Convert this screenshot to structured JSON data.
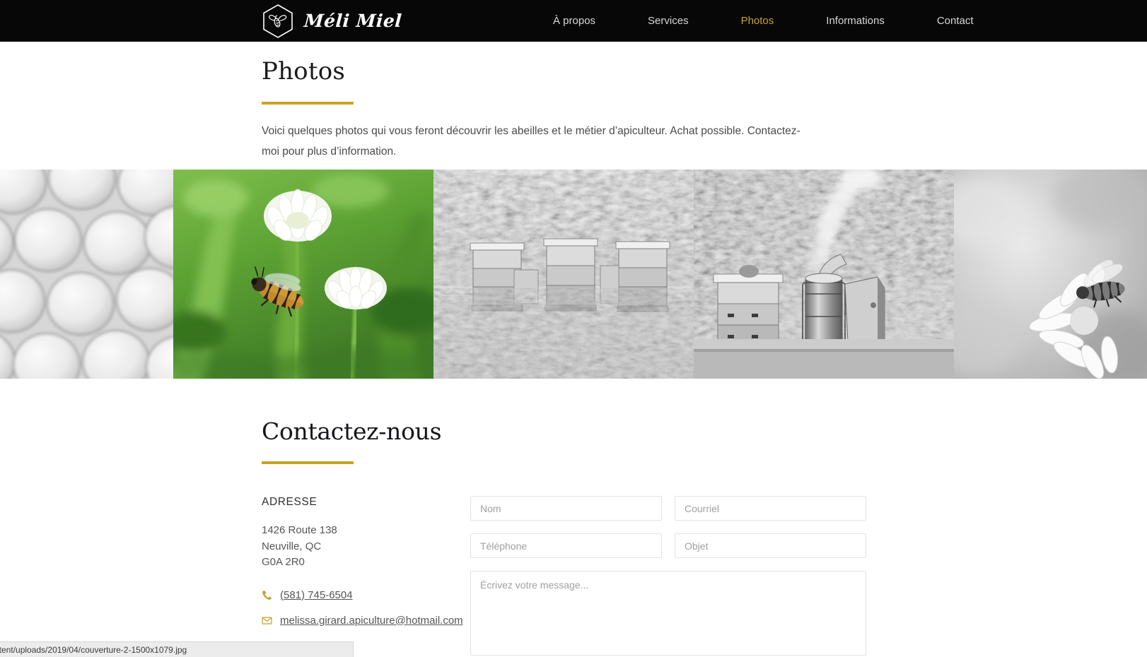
{
  "header": {
    "brand_name": "Méli Miel",
    "logo_icon": "hexagon-bee-icon",
    "nav": [
      {
        "label": "À propos",
        "active": false
      },
      {
        "label": "Services",
        "active": false
      },
      {
        "label": "Photos",
        "active": true
      },
      {
        "label": "Informations",
        "active": false
      },
      {
        "label": "Contact",
        "active": false
      }
    ]
  },
  "intro": {
    "title": "Photos",
    "text": "Voici quelques photos qui vous feront découvrir les abeilles et le métier d’apiculteur. Achat possible. Contactez-moi pour plus d’information."
  },
  "gallery": {
    "tiles": [
      {
        "name": "honeycomb-photo",
        "alt": "Gros plan de rayon de miel",
        "color": false
      },
      {
        "name": "bee-on-clover-photo",
        "alt": "Abeille sur une fleur de trèfle blanc",
        "color": true
      },
      {
        "name": "apiary-hives-photo",
        "alt": "Ruches dans un champ",
        "color": false
      },
      {
        "name": "smoker-hive-photo",
        "alt": "Enfumoir et ruche",
        "color": false
      },
      {
        "name": "bee-on-flower-photo",
        "alt": "Abeille sur une fleur blanche",
        "color": false
      }
    ]
  },
  "contact": {
    "title": "Contactez-nous",
    "address_label": "ADRESSE",
    "address_lines": [
      "1426 Route 138",
      "Neuville, QC",
      "G0A 2R0"
    ],
    "phone": "(581) 745-6504",
    "phone_icon": "phone-icon",
    "email": "melissa.girard.apiculture@hotmail.com",
    "email_icon": "envelope-icon",
    "form": {
      "name_placeholder": "Nom",
      "email_placeholder": "Courriel",
      "phone_placeholder": "Téléphone",
      "subject_placeholder": "Objet",
      "message_placeholder": "Écrivez votre message...",
      "name_value": "",
      "email_value": "",
      "phone_value": "",
      "subject_value": "",
      "message_value": ""
    }
  },
  "status_bar": {
    "url": "ntent/uploads/2019/04/couverture-2-1500x1079.jpg"
  },
  "colors": {
    "accent": "#c9a227",
    "header_bg": "#070707",
    "nav_text": "#d8d8d8"
  }
}
